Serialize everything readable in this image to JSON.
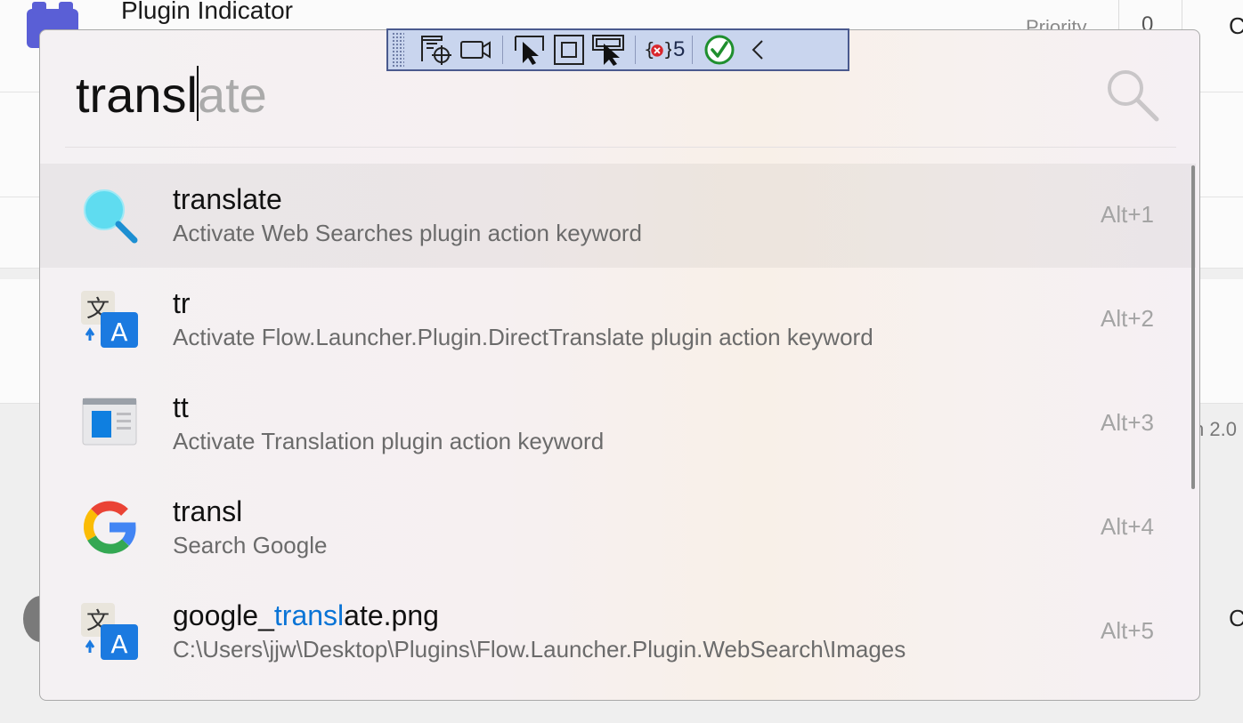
{
  "background": {
    "title": "Plugin Indicator",
    "priority_label": "Priority",
    "priority_value": "0",
    "right_char_1": "C",
    "right_char_2": "C",
    "version_fragment": "n 2.0"
  },
  "query": {
    "typed": "transl",
    "suggestion": "ate"
  },
  "toolbar": {
    "error_count": "5"
  },
  "results": [
    {
      "title": "translate",
      "subtitle": "Activate Web Searches plugin action keyword",
      "hotkey": "Alt+1",
      "icon": "magnifier-icon"
    },
    {
      "title": "tr",
      "subtitle": "Activate Flow.Launcher.Plugin.DirectTranslate plugin action keyword",
      "hotkey": "Alt+2",
      "icon": "translate-icon"
    },
    {
      "title": "tt",
      "subtitle": "Activate Translation plugin action keyword",
      "hotkey": "Alt+3",
      "icon": "window-app-icon"
    },
    {
      "title": "transl",
      "subtitle": "Search Google",
      "hotkey": "Alt+4",
      "icon": "google-icon"
    },
    {
      "title_pre": "google_",
      "title_match": "transl",
      "title_post": "ate.png",
      "subtitle": "C:\\Users\\jjw\\Desktop\\Plugins\\Flow.Launcher.Plugin.WebSearch\\Images",
      "hotkey": "Alt+5",
      "icon": "translate-icon"
    }
  ],
  "colors": {
    "accent": "#0a74d6",
    "toolbar_bg": "#c9d5ee"
  }
}
